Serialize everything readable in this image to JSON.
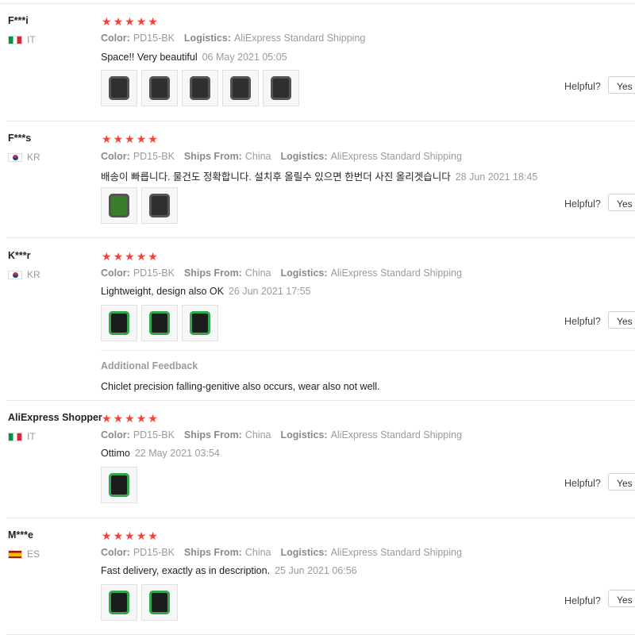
{
  "reviews": [
    {
      "user": "F***i",
      "country": "IT",
      "flag": "it",
      "stars": 5,
      "color_label": "Color:",
      "color": "PD15-BK",
      "ships_label": "",
      "ships": "",
      "logistics_label": "Logistics:",
      "logistics": "AliExpress Standard Shipping",
      "text": "Space!! Very beautiful",
      "date": "06 May 2021 05:05",
      "photos": 5,
      "helpful_label": "Helpful?",
      "yes_label": "Yes ("
    },
    {
      "user": "F***s",
      "country": "KR",
      "flag": "kr",
      "stars": 5,
      "color_label": "Color:",
      "color": "PD15-BK",
      "ships_label": "Ships From:",
      "ships": "China",
      "logistics_label": "Logistics:",
      "logistics": "AliExpress Standard Shipping",
      "text": "배송이 빠릅니다. 물건도 정확합니다. 설치후 올릴수 있으면 한번더 사진 올리겟습니다",
      "date": "28 Jun 2021 18:45",
      "photos": 2,
      "helpful_label": "Helpful?",
      "yes_label": "Yes ("
    },
    {
      "user": "K***r",
      "country": "KR",
      "flag": "kr",
      "stars": 5,
      "color_label": "Color:",
      "color": "PD15-BK",
      "ships_label": "Ships From:",
      "ships": "China",
      "logistics_label": "Logistics:",
      "logistics": "AliExpress Standard Shipping",
      "text": "Lightweight, design also OK",
      "date": "26 Jun 2021 17:55",
      "photos": 3,
      "helpful_label": "Helpful?",
      "yes_label": "Yes (",
      "additional_title": "Additional Feedback",
      "additional_text": "Chiclet precision falling-genitive also occurs, wear also not well."
    },
    {
      "user": "AliExpress Shopper",
      "country": "IT",
      "flag": "it",
      "stars": 5,
      "color_label": "Color:",
      "color": "PD15-BK",
      "ships_label": "Ships From:",
      "ships": "China",
      "logistics_label": "Logistics:",
      "logistics": "AliExpress Standard Shipping",
      "text": "Ottimo",
      "date": "22 May 2021 03:54",
      "photos": 1,
      "helpful_label": "Helpful?",
      "yes_label": "Yes ("
    },
    {
      "user": "M***e",
      "country": "ES",
      "flag": "es",
      "stars": 5,
      "color_label": "Color:",
      "color": "PD15-BK",
      "ships_label": "Ships From:",
      "ships": "China",
      "logistics_label": "Logistics:",
      "logistics": "AliExpress Standard Shipping",
      "text": "Fast delivery, exactly as in description.",
      "date": "25 Jun 2021 06:56",
      "photos": 2,
      "helpful_label": "Helpful?",
      "yes_label": "Yes ("
    }
  ],
  "colors": {
    "star": "#f44336",
    "meta": "#9b9b9b",
    "text": "#222222"
  }
}
